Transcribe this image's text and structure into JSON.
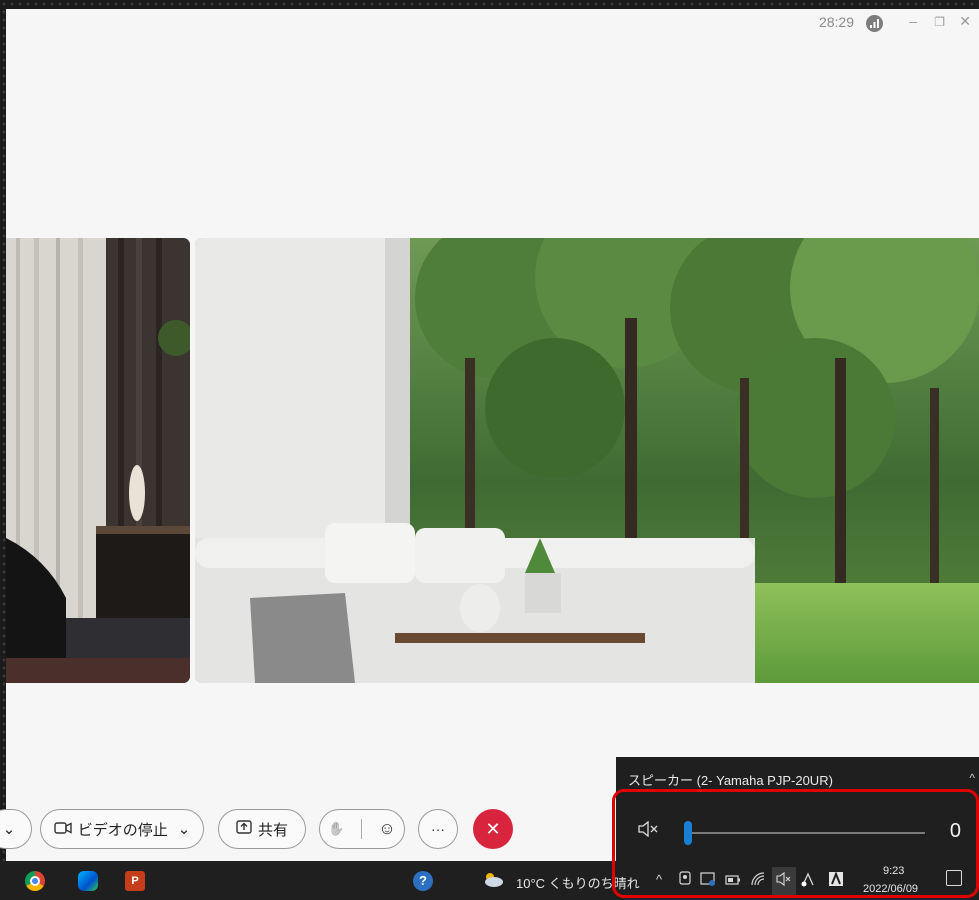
{
  "titlebar": {
    "timer": "28:29",
    "minimize": "–",
    "maximize": "❐",
    "close": "✕"
  },
  "toolbar": {
    "left_chevron": "⌄",
    "stop_video_label": "ビデオの停止",
    "stop_video_chevron": "⌄",
    "share_label": "共有",
    "raise_hand": "✋",
    "reactions": "☺",
    "more": "···",
    "leave": "✕"
  },
  "volume_flyout": {
    "device": "スピーカー (2- Yamaha PJP-20UR)",
    "expand_chevron": "^",
    "mute_icon": "🔇",
    "value": "0",
    "level": 0
  },
  "taskbar": {
    "weather_text": "10°C くもりのち晴れ",
    "tray_chevron": "^",
    "time": "9:23",
    "date": "2022/06/09",
    "ppt_label": "P"
  },
  "colors": {
    "accent": "#1a7fd4",
    "leave": "#d9243d",
    "highlight": "#e00000"
  }
}
